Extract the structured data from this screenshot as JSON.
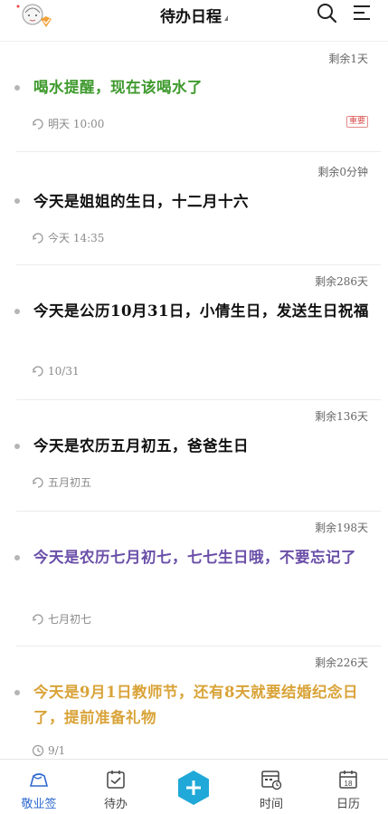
{
  "header": {
    "title": "待办日程",
    "icons": [
      "avatar-badge-icon",
      "search-icon",
      "menu-icon"
    ]
  },
  "items": [
    {
      "remaining": "剩余1天",
      "text": "喝水提醒，现在该喝水了",
      "color": "#3f9a2e",
      "meta": "明天 10:00",
      "tag": "重要",
      "meta_icon": "repeat-icon"
    },
    {
      "remaining": "剩余0分钟",
      "text": "今天是姐姐的生日，十二月十六",
      "color": "#111111",
      "meta": "今天 14:35",
      "meta_icon": "repeat-year-icon"
    },
    {
      "remaining": "剩余286天",
      "text": "今天是公历10月31日，小倩生日，发送生日祝福",
      "color": "#111111",
      "meta": "10/31",
      "meta_icon": "repeat-year-icon"
    },
    {
      "remaining": "剩余136天",
      "text": "今天是农历五月初五，爸爸生日",
      "color": "#111111",
      "meta": "五月初五",
      "meta_icon": "repeat-year-icon"
    },
    {
      "remaining": "剩余198天",
      "text": "今天是农历七月初七，七七生日哦，不要忘记了",
      "color": "#6a4fa8",
      "meta": "七月初七",
      "meta_icon": "repeat-year-icon"
    },
    {
      "remaining": "剩余226天",
      "text": "今天是9月1日教师节，还有8天就要结婚纪念日了，提前准备礼物",
      "color": "#d9a338",
      "meta": "9/1",
      "meta_icon": "clock-icon"
    }
  ],
  "tabs": [
    {
      "label": "敬业签",
      "icon": "home-note-icon",
      "active": true
    },
    {
      "label": "待办",
      "icon": "todo-check-icon",
      "active": false
    },
    {
      "label": "",
      "icon": "add-icon",
      "active": false
    },
    {
      "label": "时间",
      "icon": "time-calendar-icon",
      "active": false
    },
    {
      "label": "日历",
      "icon": "calendar-icon",
      "active": false
    }
  ],
  "calendar_day": "18",
  "colors": {
    "accent": "#2f6ad0",
    "add_button": "#1fa8d8"
  }
}
